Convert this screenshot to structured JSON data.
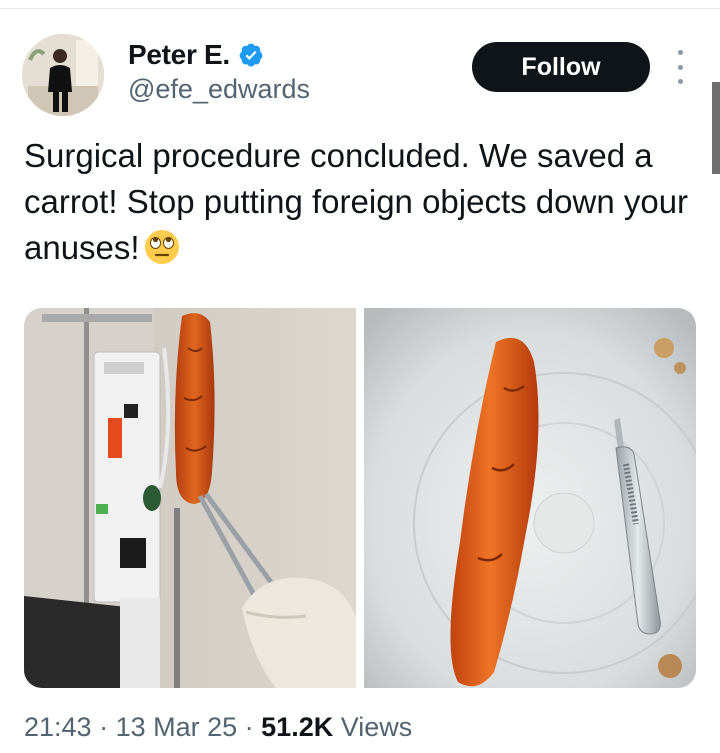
{
  "author": {
    "name": "Peter E.",
    "handle": "@efe_edwards",
    "verified": true
  },
  "actions": {
    "follow_label": "Follow",
    "more_icon": "more-vertical-icon"
  },
  "tweet": {
    "text": "Surgical procedure concluded. We saved a carrot! Stop putting foreign objects down your anuses!",
    "emoji": "face-with-rolling-eyes",
    "media": [
      {
        "kind": "photo"
      },
      {
        "kind": "photo"
      }
    ]
  },
  "meta": {
    "time": "21:43",
    "sep1": " · ",
    "date": "13 Mar 25",
    "sep2": " · ",
    "views_count": "51.2K",
    "views_label": " Views"
  },
  "colors": {
    "text": "#0f1419",
    "secondary": "#536471",
    "verified": "#1d9bf0",
    "follow_bg": "#0f1419"
  }
}
